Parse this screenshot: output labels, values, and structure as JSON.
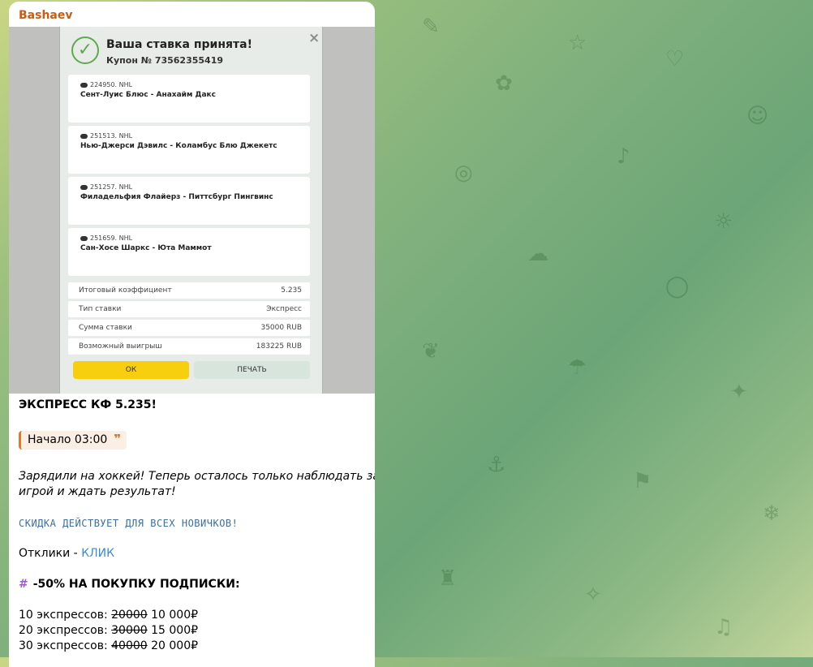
{
  "sender": "Bashaev",
  "coupon": {
    "title": "Ваша ставка принята!",
    "coupon_number": "Купон № 73562355419",
    "close": "×",
    "events": [
      {
        "code": "224950. NHL",
        "match": "Сент-Луис Блюс - Анахайм Дакс"
      },
      {
        "code": "251513. NHL",
        "match": "Нью-Джерси Дэвилс - Коламбус Блю Джекетс"
      },
      {
        "code": "251257. NHL",
        "match": "Филадельфия Флайерз - Питтсбург Пингвинс"
      },
      {
        "code": "251659. NHL",
        "match": "Сан-Хосе Шаркс - Юта Маммот"
      }
    ],
    "summary": [
      {
        "label": "Итоговый коэффициент",
        "value": "5.235"
      },
      {
        "label": "Тип ставки",
        "value": "Экспресс"
      },
      {
        "label": "Сумма ставки",
        "value": "35000 RUB"
      },
      {
        "label": "Возможный выигрыш",
        "value": "183225 RUB"
      }
    ],
    "ok_label": "ОК",
    "print_label": "ПЕЧАТЬ"
  },
  "text": {
    "headline": "ЭКСПРЕСС КФ 5.235!",
    "start_quote": "Начало 03:00",
    "quote_mark": "❞",
    "body_line1": "Зарядили на хоккей! Теперь осталось только наблюдать за",
    "body_line2": "игрой и ждать результат!",
    "discount": "СКИДКА ДЕЙСТВУЕТ ДЛЯ ВСЕХ НОВИЧКОВ!",
    "responses_label": "Отклики - ",
    "responses_link": "КЛИК",
    "promo_hash": "#",
    "promo": "-50% НА ПОКУПКУ ПОДПИСКИ:",
    "prices": [
      {
        "label": "10 экспрессов: ",
        "old": "20000",
        "new": " 10 000₽"
      },
      {
        "label": "20 экспрессов: ",
        "old": "30000",
        "new": " 15 000₽"
      },
      {
        "label": "30 экспрессов: ",
        "old": "40000",
        "new": " 20 000₽"
      }
    ]
  }
}
